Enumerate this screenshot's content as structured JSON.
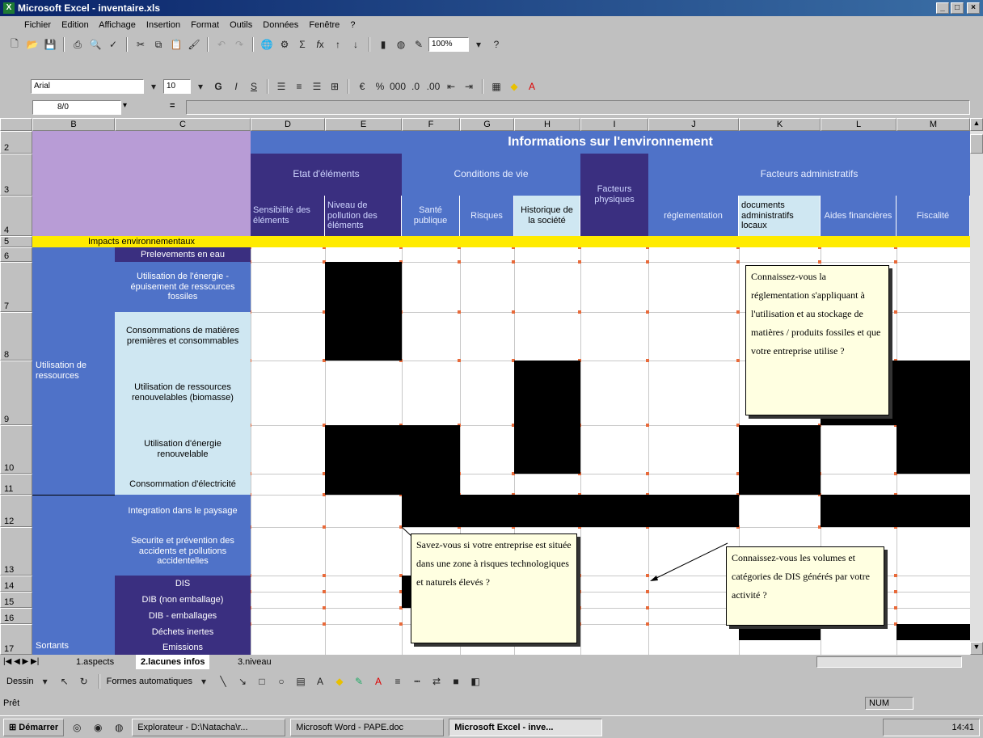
{
  "window": {
    "title": "Microsoft Excel - inventaire.xls"
  },
  "menu": [
    "Fichier",
    "Edition",
    "Affichage",
    "Insertion",
    "Format",
    "Outils",
    "Données",
    "Fenêtre",
    "?"
  ],
  "toolbar": {
    "zoom": "100%",
    "font": "Arial",
    "size": "10",
    "bold": "G",
    "italic": "I",
    "underline": "S"
  },
  "formula": {
    "namebox": "8/0",
    "equals": "="
  },
  "columns": [
    "B",
    "C",
    "D",
    "E",
    "F",
    "G",
    "H",
    "I",
    "J",
    "K",
    "L",
    "M"
  ],
  "rows": [
    "2",
    "3",
    "4",
    "5",
    "6",
    "7",
    "8",
    "9",
    "10",
    "11",
    "12",
    "13",
    "14",
    "15",
    "16",
    "17"
  ],
  "header": {
    "main": "Informations sur l'environnement",
    "group_etat": "Etat d'éléments",
    "group_conditions": "Conditions de vie",
    "facteurs_physiques": "Facteurs physiques",
    "group_admin": "Facteurs administratifs",
    "sub": [
      "Sensibilité des éléments",
      "Niveau de pollution des éléments",
      "Santé publique",
      "Risques",
      "Historique de la société",
      "réglementation",
      "documents administratifs locaux",
      "Aides financières",
      "Fiscalité"
    ]
  },
  "impacts_label": "Impacts environnementaux",
  "groups": {
    "ressources": "Utilisation de ressources",
    "sortants": "Sortants"
  },
  "items": [
    "Prelevements en eau",
    "Utilisation de l'énergie - épuisement de ressources fossiles",
    "Consommations de matières premières et consommables",
    "Utilisation de ressources renouvelables (biomasse)",
    "Utilisation d'énergie renouvelable",
    "Consommation d'électricité",
    "Integration dans le paysage",
    "Securite et prévention des accidents et pollutions accidentelles",
    "DIS",
    "DIB (non emballage)",
    "DIB - emballages",
    "Déchets inertes",
    "Emissions"
  ],
  "notes": {
    "n1": "Connaissez-vous la réglementation s'appliquant à l'utilisation et au stockage de matières / produits fossiles et que votre entreprise utilise ?",
    "n2": "Savez-vous si votre entreprise est située dans une zone à risques technologiques et naturels élevés ?",
    "n3": "Connaissez-vous les volumes et catégories de DIS générés par votre activité ?"
  },
  "sheets": [
    "1.aspects",
    "2.lacunes infos",
    "3.niveau"
  ],
  "drawbar": {
    "dessin": "Dessin",
    "formes": "Formes automatiques"
  },
  "status": {
    "ready": "Prêt",
    "num": "NUM"
  },
  "taskbar": {
    "start": "Démarrer",
    "t1": "Explorateur - D:\\Natacha\\r...",
    "t2": "Microsoft Word - PAPE.doc",
    "t3": "Microsoft Excel - inve...",
    "clock": "14:41"
  },
  "colors": {
    "purple": "#b89cd6",
    "darkblue": "#3a2f80",
    "blue": "#4f72c8",
    "lightblue": "#cfe7f2",
    "yellow": "#ffeb00"
  }
}
